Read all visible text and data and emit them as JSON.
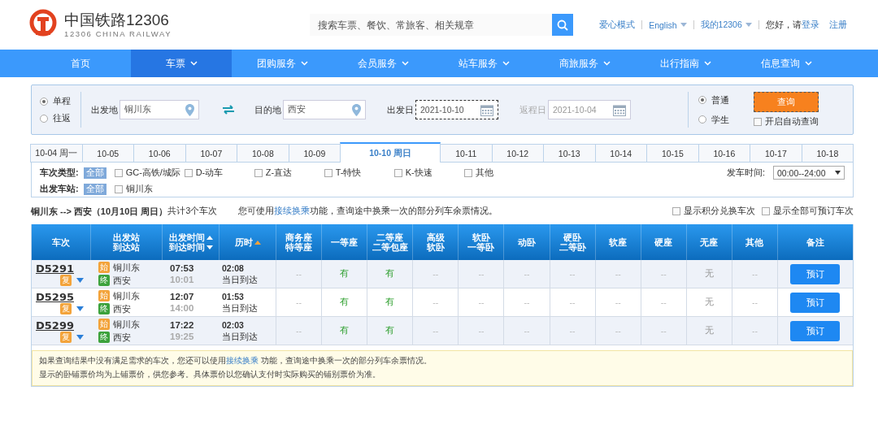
{
  "header": {
    "logo_title": "中国铁路12306",
    "logo_subtitle": "12306 CHINA RAILWAY",
    "search_placeholder": "搜索车票、餐饮、常旅客、相关规章",
    "top_links": [
      {
        "label": "爱心模式",
        "kind": "link"
      },
      {
        "label": "English",
        "kind": "dropdown"
      },
      {
        "label": "我的12306",
        "kind": "dropdown"
      }
    ],
    "greeting": "您好，请",
    "login": "登录",
    "register": "注册"
  },
  "nav": [
    {
      "label": "首页",
      "selected": false,
      "has_menu": false
    },
    {
      "label": "车票",
      "selected": true,
      "has_menu": true
    },
    {
      "label": "团购服务",
      "selected": false,
      "has_menu": true
    },
    {
      "label": "会员服务",
      "selected": false,
      "has_menu": true
    },
    {
      "label": "站车服务",
      "selected": false,
      "has_menu": true
    },
    {
      "label": "商旅服务",
      "selected": false,
      "has_menu": true
    },
    {
      "label": "出行指南",
      "selected": false,
      "has_menu": true
    },
    {
      "label": "信息查询",
      "selected": false,
      "has_menu": true
    }
  ],
  "query": {
    "trip_types": [
      {
        "label": "单程",
        "selected": true
      },
      {
        "label": "往返",
        "selected": false
      }
    ],
    "from": {
      "label": "出发地",
      "value": "铜川东"
    },
    "to": {
      "label": "目的地",
      "value": "西安"
    },
    "depart": {
      "label": "出发日",
      "value": "2021-10-10",
      "disabled": false
    },
    "return": {
      "label": "返程日",
      "value": "2021-10-04",
      "disabled": true
    },
    "passenger_types": [
      {
        "label": "普通",
        "selected": true
      },
      {
        "label": "学生",
        "selected": false
      }
    ],
    "search_button": "查询",
    "auto_query": {
      "label": "开启自动查询",
      "checked": false
    }
  },
  "date_tabs": [
    {
      "label": "10-04 周一",
      "selected": false
    },
    {
      "label": "10-05",
      "selected": false
    },
    {
      "label": "10-06",
      "selected": false
    },
    {
      "label": "10-07",
      "selected": false
    },
    {
      "label": "10-08",
      "selected": false
    },
    {
      "label": "10-09",
      "selected": false
    },
    {
      "label": "10-10 周日",
      "selected": true
    },
    {
      "label": "10-11",
      "selected": false
    },
    {
      "label": "10-12",
      "selected": false
    },
    {
      "label": "10-13",
      "selected": false
    },
    {
      "label": "10-14",
      "selected": false
    },
    {
      "label": "10-15",
      "selected": false
    },
    {
      "label": "10-16",
      "selected": false
    },
    {
      "label": "10-17",
      "selected": false
    },
    {
      "label": "10-18",
      "selected": false
    }
  ],
  "filters": {
    "train_type_label": "车次类型:",
    "train_type_all": "全部",
    "train_types": [
      {
        "label": "GC-高铁/城际",
        "checked": false
      },
      {
        "label": "D-动车",
        "checked": false
      },
      {
        "label": "Z-直达",
        "checked": false
      },
      {
        "label": "T-特快",
        "checked": false
      },
      {
        "label": "K-快速",
        "checked": false
      },
      {
        "label": "其他",
        "checked": false
      }
    ],
    "time_label": "发车时间:",
    "time_value": "00:00--24:00",
    "station_label": "出发车站:",
    "station_all": "全部",
    "stations": [
      {
        "label": "铜川东",
        "checked": false
      }
    ]
  },
  "summary": {
    "route": "铜川东 --> 西安（10月10日  周日）",
    "count": "共计3个车次",
    "hint_before": "您可使用",
    "hint_link": "接续换乘",
    "hint_after": "功能，查询途中换乘一次的部分列车余票情况。",
    "options": [
      {
        "label": "显示积分兑换车次",
        "checked": false
      },
      {
        "label": "显示全部可预订车次",
        "checked": false
      }
    ]
  },
  "table": {
    "columns": [
      {
        "lines": [
          {
            "text": "车次",
            "kind": "plain"
          }
        ]
      },
      {
        "lines": [
          {
            "text": "出发站",
            "kind": "plain"
          },
          {
            "text": "到达站",
            "kind": "plain"
          }
        ]
      },
      {
        "lines": [
          {
            "text": "出发时间",
            "kind": "sort_up"
          },
          {
            "text": "到达时间",
            "kind": "sort_down"
          }
        ]
      },
      {
        "lines": [
          {
            "text": "历时",
            "kind": "sort_active"
          }
        ]
      },
      {
        "lines": [
          {
            "text": "商务座",
            "kind": "plain"
          },
          {
            "text": "特等座",
            "kind": "plain"
          }
        ]
      },
      {
        "lines": [
          {
            "text": "一等座",
            "kind": "plain"
          }
        ]
      },
      {
        "lines": [
          {
            "text": "二等座",
            "kind": "plain"
          },
          {
            "text": "二等包座",
            "kind": "plain"
          }
        ]
      },
      {
        "lines": [
          {
            "text": "高级",
            "kind": "plain"
          },
          {
            "text": "软卧",
            "kind": "plain"
          }
        ]
      },
      {
        "lines": [
          {
            "text": "软卧",
            "kind": "plain"
          },
          {
            "text": "一等卧",
            "kind": "plain"
          }
        ]
      },
      {
        "lines": [
          {
            "text": "动卧",
            "kind": "plain"
          }
        ]
      },
      {
        "lines": [
          {
            "text": "硬卧",
            "kind": "plain"
          },
          {
            "text": "二等卧",
            "kind": "plain"
          }
        ]
      },
      {
        "lines": [
          {
            "text": "软座",
            "kind": "plain"
          }
        ]
      },
      {
        "lines": [
          {
            "text": "硬座",
            "kind": "plain"
          }
        ]
      },
      {
        "lines": [
          {
            "text": "无座",
            "kind": "plain"
          }
        ]
      },
      {
        "lines": [
          {
            "text": "其他",
            "kind": "plain"
          }
        ]
      },
      {
        "lines": [
          {
            "text": "备注",
            "kind": "plain"
          }
        ]
      }
    ],
    "rows": [
      {
        "train": "D5291",
        "train_badge": "复",
        "from_badge": "始",
        "from": "铜川东",
        "to_badge": "终",
        "to": "西安",
        "depart": "07:53",
        "arrive": "10:01",
        "duration": "02:08",
        "arrival_day": "当日到达",
        "seats": [
          {
            "text": "--",
            "kind": "na"
          },
          {
            "text": "有",
            "kind": "available"
          },
          {
            "text": "有",
            "kind": "available"
          },
          {
            "text": "--",
            "kind": "na"
          },
          {
            "text": "--",
            "kind": "na"
          },
          {
            "text": "--",
            "kind": "na"
          },
          {
            "text": "--",
            "kind": "na"
          },
          {
            "text": "--",
            "kind": "na"
          },
          {
            "text": "--",
            "kind": "na"
          },
          {
            "text": "无",
            "kind": "sold_out"
          },
          {
            "text": "--",
            "kind": "na"
          }
        ],
        "action": "预订"
      },
      {
        "train": "D5295",
        "train_badge": "复",
        "from_badge": "始",
        "from": "铜川东",
        "to_badge": "终",
        "to": "西安",
        "depart": "12:07",
        "arrive": "14:00",
        "duration": "01:53",
        "arrival_day": "当日到达",
        "seats": [
          {
            "text": "--",
            "kind": "na"
          },
          {
            "text": "有",
            "kind": "available"
          },
          {
            "text": "有",
            "kind": "available"
          },
          {
            "text": "--",
            "kind": "na"
          },
          {
            "text": "--",
            "kind": "na"
          },
          {
            "text": "--",
            "kind": "na"
          },
          {
            "text": "--",
            "kind": "na"
          },
          {
            "text": "--",
            "kind": "na"
          },
          {
            "text": "--",
            "kind": "na"
          },
          {
            "text": "无",
            "kind": "sold_out"
          },
          {
            "text": "--",
            "kind": "na"
          }
        ],
        "action": "预订"
      },
      {
        "train": "D5299",
        "train_badge": "复",
        "from_badge": "始",
        "from": "铜川东",
        "to_badge": "终",
        "to": "西安",
        "depart": "17:22",
        "arrive": "19:25",
        "duration": "02:03",
        "arrival_day": "当日到达",
        "seats": [
          {
            "text": "--",
            "kind": "na"
          },
          {
            "text": "有",
            "kind": "available"
          },
          {
            "text": "有",
            "kind": "available"
          },
          {
            "text": "--",
            "kind": "na"
          },
          {
            "text": "--",
            "kind": "na"
          },
          {
            "text": "--",
            "kind": "na"
          },
          {
            "text": "--",
            "kind": "na"
          },
          {
            "text": "--",
            "kind": "na"
          },
          {
            "text": "--",
            "kind": "na"
          },
          {
            "text": "无",
            "kind": "sold_out"
          },
          {
            "text": "--",
            "kind": "na"
          }
        ],
        "action": "预订"
      }
    ]
  },
  "notes": [
    {
      "before": "如果查询结果中没有满足需求的车次，您还可以使用",
      "link": "接续换乘",
      "after": " 功能，查询途中换乘一次的部分列车余票情况。"
    },
    {
      "before": "显示的卧铺票价均为上铺票价，供您参考。具体票价以您确认支付时实际购买的铺别票价为准。"
    }
  ]
}
